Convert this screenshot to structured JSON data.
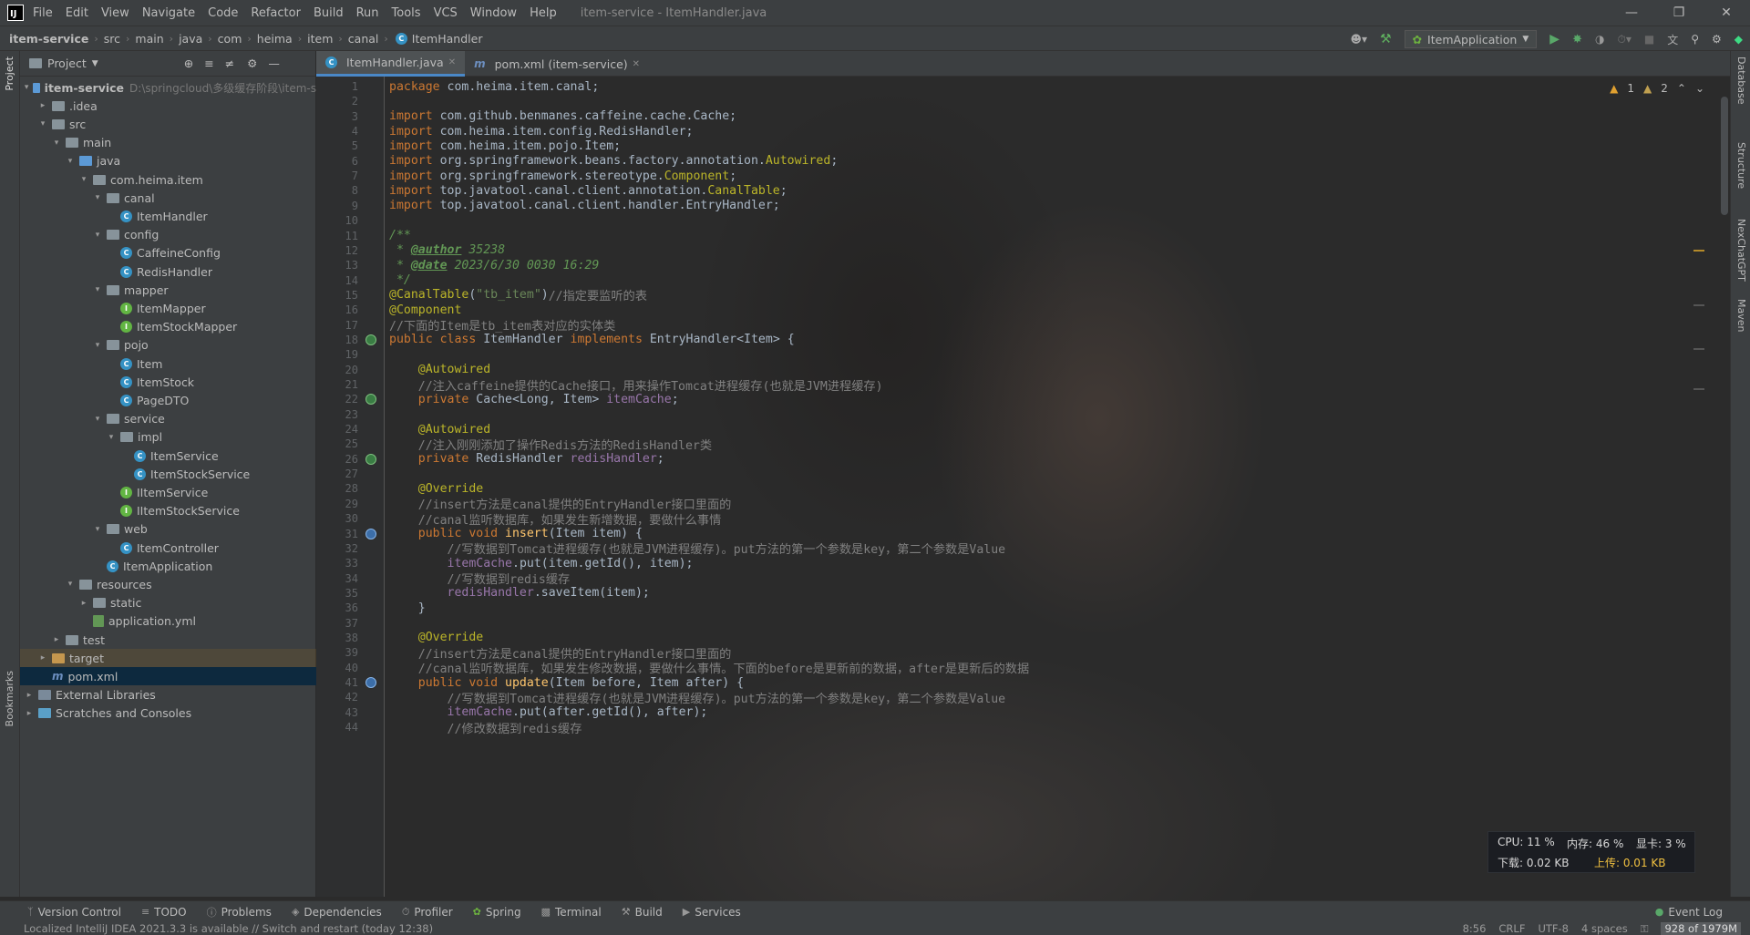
{
  "window": {
    "title": "item-service - ItemHandler.java"
  },
  "menu": [
    "File",
    "Edit",
    "View",
    "Navigate",
    "Code",
    "Refactor",
    "Build",
    "Run",
    "Tools",
    "VCS",
    "Window",
    "Help"
  ],
  "breadcrumb": [
    "item-service",
    "src",
    "main",
    "java",
    "com",
    "heima",
    "item",
    "canal",
    "ItemHandler"
  ],
  "run_config": "ItemApplication",
  "project_panel": {
    "title": "Project"
  },
  "tree": [
    {
      "label": "item-service",
      "type": "module",
      "indent": 0,
      "open": true,
      "path": "D:\\springcloud\\多级缓存阶段\\item-s"
    },
    {
      "label": ".idea",
      "type": "folder",
      "indent": 1,
      "open": false
    },
    {
      "label": "src",
      "type": "folder",
      "indent": 1,
      "open": true
    },
    {
      "label": "main",
      "type": "folder",
      "indent": 2,
      "open": true
    },
    {
      "label": "java",
      "type": "folder-blue",
      "indent": 3,
      "open": true
    },
    {
      "label": "com.heima.item",
      "type": "folder",
      "indent": 4,
      "open": true
    },
    {
      "label": "canal",
      "type": "folder",
      "indent": 5,
      "open": true
    },
    {
      "label": "ItemHandler",
      "type": "class",
      "indent": 6
    },
    {
      "label": "config",
      "type": "folder",
      "indent": 5,
      "open": true
    },
    {
      "label": "CaffeineConfig",
      "type": "class",
      "indent": 6
    },
    {
      "label": "RedisHandler",
      "type": "class",
      "indent": 6
    },
    {
      "label": "mapper",
      "type": "folder",
      "indent": 5,
      "open": true
    },
    {
      "label": "ItemMapper",
      "type": "interface",
      "indent": 6
    },
    {
      "label": "ItemStockMapper",
      "type": "interface",
      "indent": 6
    },
    {
      "label": "pojo",
      "type": "folder",
      "indent": 5,
      "open": true
    },
    {
      "label": "Item",
      "type": "class",
      "indent": 6
    },
    {
      "label": "ItemStock",
      "type": "class",
      "indent": 6
    },
    {
      "label": "PageDTO",
      "type": "class",
      "indent": 6
    },
    {
      "label": "service",
      "type": "folder",
      "indent": 5,
      "open": true
    },
    {
      "label": "impl",
      "type": "folder",
      "indent": 6,
      "open": true
    },
    {
      "label": "ItemService",
      "type": "class",
      "indent": 7
    },
    {
      "label": "ItemStockService",
      "type": "class",
      "indent": 7
    },
    {
      "label": "IItemService",
      "type": "interface",
      "indent": 6
    },
    {
      "label": "IItemStockService",
      "type": "interface",
      "indent": 6
    },
    {
      "label": "web",
      "type": "folder",
      "indent": 5,
      "open": true
    },
    {
      "label": "ItemController",
      "type": "class",
      "indent": 6
    },
    {
      "label": "ItemApplication",
      "type": "class",
      "indent": 5
    },
    {
      "label": "resources",
      "type": "folder",
      "indent": 3,
      "open": true
    },
    {
      "label": "static",
      "type": "folder",
      "indent": 4,
      "open": false
    },
    {
      "label": "application.yml",
      "type": "yml",
      "indent": 4
    },
    {
      "label": "test",
      "type": "folder",
      "indent": 2,
      "open": false
    },
    {
      "label": "target",
      "type": "folder-orange",
      "indent": 1,
      "open": false
    },
    {
      "label": "pom.xml",
      "type": "maven",
      "indent": 1
    },
    {
      "label": "External Libraries",
      "type": "lib",
      "indent": 0,
      "open": false
    },
    {
      "label": "Scratches and Consoles",
      "type": "scratch",
      "indent": 0,
      "open": false
    }
  ],
  "tabs": [
    {
      "label": "ItemHandler.java",
      "active": true
    },
    {
      "label": "pom.xml (item-service)",
      "active": false
    }
  ],
  "inspections": {
    "warnings": "1",
    "weak": "2"
  },
  "code": [
    [
      [
        "kw",
        "package "
      ],
      [
        "pl",
        "com.heima.item.canal;"
      ]
    ],
    [],
    [
      [
        "kw",
        "import "
      ],
      [
        "pl",
        "com.github.benmanes.caffeine.cache.Cache;"
      ]
    ],
    [
      [
        "kw",
        "import "
      ],
      [
        "pl",
        "com.heima.item.config.RedisHandler;"
      ]
    ],
    [
      [
        "kw",
        "import "
      ],
      [
        "pl",
        "com.heima.item.pojo.Item;"
      ]
    ],
    [
      [
        "kw",
        "import "
      ],
      [
        "pl",
        "org.springframework.beans.factory.annotation."
      ],
      [
        "ann",
        "Autowired"
      ],
      [
        "pl",
        ";"
      ]
    ],
    [
      [
        "kw",
        "import "
      ],
      [
        "pl",
        "org.springframework.stereotype."
      ],
      [
        "ann",
        "Component"
      ],
      [
        "pl",
        ";"
      ]
    ],
    [
      [
        "kw",
        "import "
      ],
      [
        "pl",
        "top.javatool.canal.client.annotation."
      ],
      [
        "ann",
        "CanalTable"
      ],
      [
        "pl",
        ";"
      ]
    ],
    [
      [
        "kw",
        "import "
      ],
      [
        "pl",
        "top.javatool.canal.client.handler.EntryHandler;"
      ]
    ],
    [],
    [
      [
        "jd",
        "/**"
      ]
    ],
    [
      [
        "jd",
        " * "
      ],
      [
        "tag",
        "@author"
      ],
      [
        "jd",
        " 35238"
      ]
    ],
    [
      [
        "jd",
        " * "
      ],
      [
        "tag",
        "@date"
      ],
      [
        "jd",
        " 2023/6/30 0030 16:29"
      ]
    ],
    [
      [
        "jd",
        " */"
      ]
    ],
    [
      [
        "ann",
        "@CanalTable"
      ],
      [
        "pl",
        "("
      ],
      [
        "str",
        "\"tb_item\""
      ],
      [
        "pl",
        ")"
      ],
      [
        "cm",
        "//指定要监听的表"
      ]
    ],
    [
      [
        "ann",
        "@Component"
      ]
    ],
    [
      [
        "cm",
        "//下面的Item是tb_item表对应的实体类"
      ]
    ],
    [
      [
        "kw",
        "public class "
      ],
      [
        "pl",
        "ItemHandler "
      ],
      [
        "kw",
        "implements "
      ],
      [
        "pl",
        "EntryHandler<Item> {"
      ]
    ],
    [],
    [
      [
        "pl",
        "    "
      ],
      [
        "ann",
        "@Autowired"
      ]
    ],
    [
      [
        "pl",
        "    "
      ],
      [
        "cm",
        "//注入caffeine提供的Cache接口，用来操作Tomcat进程缓存(也就是JVM进程缓存)"
      ]
    ],
    [
      [
        "pl",
        "    "
      ],
      [
        "kw",
        "private "
      ],
      [
        "pl",
        "Cache<Long, Item> "
      ],
      [
        "fld",
        "itemCache"
      ],
      [
        "pl",
        ";"
      ]
    ],
    [],
    [
      [
        "pl",
        "    "
      ],
      [
        "ann",
        "@Autowired"
      ]
    ],
    [
      [
        "pl",
        "    "
      ],
      [
        "cm",
        "//注入刚刚添加了操作Redis方法的RedisHandler类"
      ]
    ],
    [
      [
        "pl",
        "    "
      ],
      [
        "kw",
        "private "
      ],
      [
        "pl",
        "RedisHandler "
      ],
      [
        "fld",
        "redisHandler"
      ],
      [
        "pl",
        ";"
      ]
    ],
    [],
    [
      [
        "pl",
        "    "
      ],
      [
        "ann",
        "@Override"
      ]
    ],
    [
      [
        "pl",
        "    "
      ],
      [
        "cm",
        "//insert方法是canal提供的EntryHandler接口里面的"
      ]
    ],
    [
      [
        "pl",
        "    "
      ],
      [
        "cm",
        "//canal监听数据库，如果发生新增数据，要做什么事情"
      ]
    ],
    [
      [
        "pl",
        "    "
      ],
      [
        "kw",
        "public void "
      ],
      [
        "mth",
        "insert"
      ],
      [
        "pl",
        "(Item item) {"
      ]
    ],
    [
      [
        "pl",
        "        "
      ],
      [
        "cm",
        "//写数据到Tomcat进程缓存(也就是JVM进程缓存)。put方法的第一个参数是key，第二个参数是Value"
      ]
    ],
    [
      [
        "pl",
        "        "
      ],
      [
        "fld",
        "itemCache"
      ],
      [
        "pl",
        ".put(item.getId(), item);"
      ]
    ],
    [
      [
        "pl",
        "        "
      ],
      [
        "cm",
        "//写数据到redis缓存"
      ]
    ],
    [
      [
        "pl",
        "        "
      ],
      [
        "fld",
        "redisHandler"
      ],
      [
        "pl",
        ".saveItem(item);"
      ]
    ],
    [
      [
        "pl",
        "    }"
      ]
    ],
    [],
    [
      [
        "pl",
        "    "
      ],
      [
        "ann",
        "@Override"
      ]
    ],
    [
      [
        "pl",
        "    "
      ],
      [
        "cm",
        "//insert方法是canal提供的EntryHandler接口里面的"
      ]
    ],
    [
      [
        "pl",
        "    "
      ],
      [
        "cm",
        "//canal监听数据库，如果发生修改数据，要做什么事情。下面的before是更新前的数据，after是更新后的数据"
      ]
    ],
    [
      [
        "pl",
        "    "
      ],
      [
        "kw",
        "public void "
      ],
      [
        "mth",
        "update"
      ],
      [
        "pl",
        "(Item before, Item after) {"
      ]
    ],
    [
      [
        "pl",
        "        "
      ],
      [
        "cm",
        "//写数据到Tomcat进程缓存(也就是JVM进程缓存)。put方法的第一个参数是key，第二个参数是Value"
      ]
    ],
    [
      [
        "pl",
        "        "
      ],
      [
        "fld",
        "itemCache"
      ],
      [
        "pl",
        ".put(after.getId(), after);"
      ]
    ],
    [
      [
        "pl",
        "        "
      ],
      [
        "cm",
        "//修改数据到redis缓存"
      ]
    ]
  ],
  "gutter_icons": {
    "18": "bean",
    "22": "bean",
    "26": "bean",
    "31": "override",
    "41": "override"
  },
  "sysmon": {
    "cpu": "CPU: 11 %",
    "mem": "内存: 46 %",
    "gpu": "显卡: 3 %",
    "down": "下载: 0.02 KB",
    "up": "上传: 0.01 KB"
  },
  "right_tools": [
    "Database",
    "Structure",
    "NexChatGPT",
    "Maven"
  ],
  "left_tools": [
    "Project",
    "Bookmarks"
  ],
  "bottom_tools": [
    "Version Control",
    "TODO",
    "Problems",
    "Dependencies",
    "Profiler",
    "Spring",
    "Terminal",
    "Build",
    "Services"
  ],
  "event_log": "Event Log",
  "status": {
    "message": "Localized IntelliJ IDEA 2021.3.3 is available // Switch and restart (today 12:38)",
    "pos": "8:56",
    "eol": "CRLF",
    "enc": "UTF-8",
    "indent": "4 spaces",
    "memory": "928 of 1979M"
  }
}
